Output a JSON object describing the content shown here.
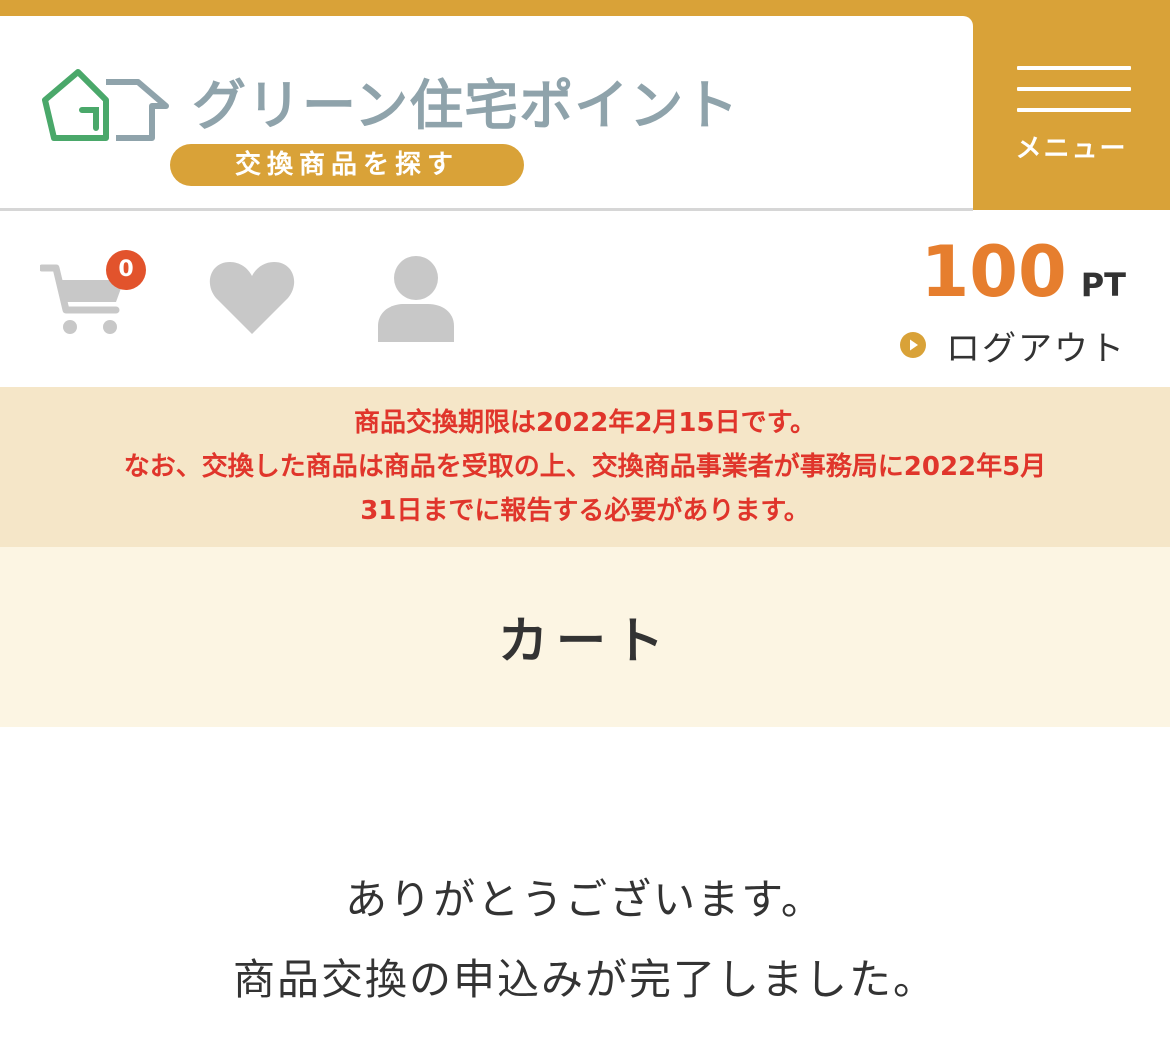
{
  "header": {
    "logo_title": "グリーン住宅ポイント",
    "logo_subtitle": "交換商品を探す",
    "menu_label": "メニュー"
  },
  "account": {
    "cart_count": "0",
    "points_value": "100",
    "points_unit": "PT",
    "logout_label": "ログアウト"
  },
  "notice": {
    "line1": "商品交換期限は2022年2月15日です。",
    "line2": "なお、交換した商品は商品を受取の上、交換商品事業者が事務局に2022年5月",
    "line3": "31日までに報告する必要があります。"
  },
  "page": {
    "title": "カート"
  },
  "message": {
    "line1": "ありがとうございます。",
    "line2": "商品交換の申込みが完了しました。"
  },
  "colors": {
    "brand_gold": "#d9a238",
    "points_orange": "#e67e2e",
    "notice_red": "#e0352b",
    "badge_red": "#e2532c",
    "logo_green": "#4aa86a",
    "logo_gray": "#8fa3ab"
  }
}
